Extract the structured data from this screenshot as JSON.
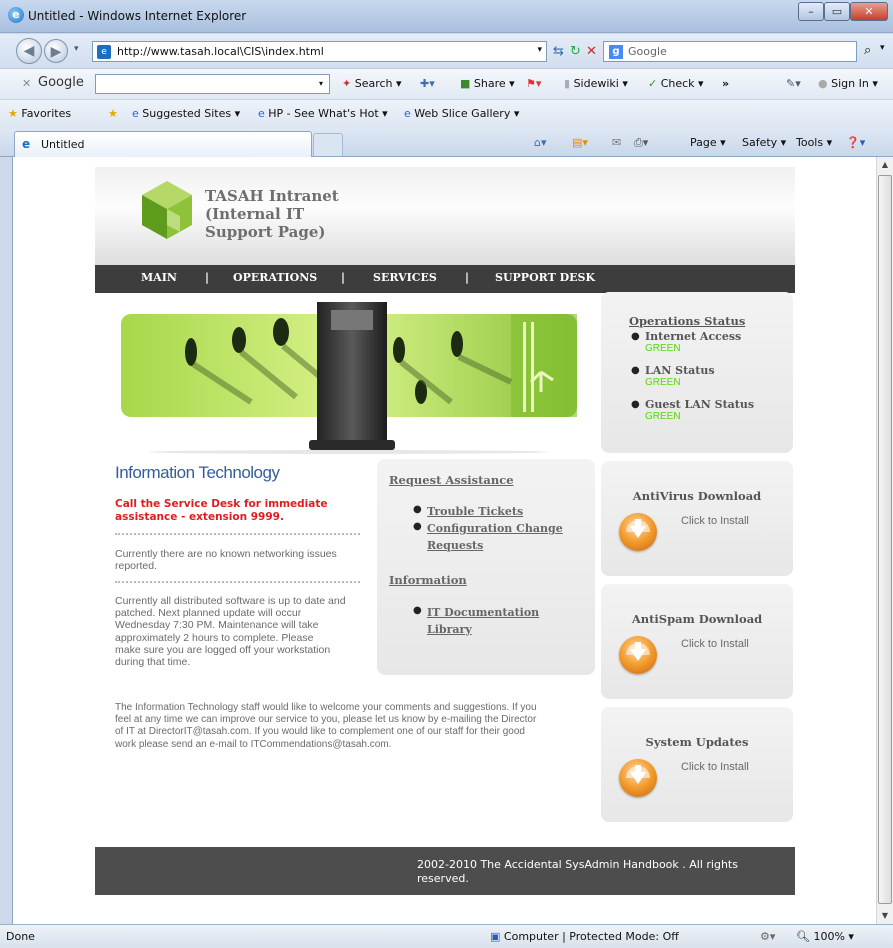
{
  "window": {
    "title": "Untitled - Windows Internet Explorer",
    "min": "–",
    "max": "▭",
    "close": "✕"
  },
  "nav": {
    "url": "http://www.tasah.local\\CIS\\index.html",
    "search_placeholder": "Google"
  },
  "google_toolbar": {
    "close": "✕",
    "brand": "Google",
    "search": "Search",
    "share": "Share",
    "sidewiki": "Sidewiki",
    "check": "Check",
    "more": "»",
    "sign_in": "Sign In"
  },
  "favorites_bar": {
    "favorites": "Favorites",
    "items": [
      "Suggested Sites",
      "HP - See What's Hot",
      "Web Slice Gallery"
    ]
  },
  "tab": {
    "title": "Untitled"
  },
  "command_bar": {
    "page": "Page",
    "safety": "Safety",
    "tools": "Tools"
  },
  "site": {
    "title_lines": [
      "TASAH Intranet",
      "(Internal IT",
      "Support Page)"
    ],
    "menu": [
      "MAIN",
      "OPERATIONS",
      "SERVICES",
      "SUPPORT DESK"
    ],
    "menu_sep": "|",
    "it_title": "Information Technology",
    "call_notice": "Call the Service Desk for immediate assistance - extension 9999.",
    "network_note": "Currently there are no known networking issues reported.",
    "software_note_lines": [
      "Currently all distributed software is up to date and",
      "patched. Next planned update will occur",
      "Wednesday 7:30 PM. Maintenance will take",
      "approximately 2 hours to complete. Please",
      "make sure you are logged off your workstation",
      "during that time."
    ],
    "welcome_lines": [
      "The Information Technology staff would like to welcome your comments and suggestions. If you",
      "feel at any time we can improve our service to you, please let us know by e-mailing the Director",
      "of IT at DirectorIT@tasah.com. If you would like to complement one of our staff for their good",
      "work please send an e-mail to ITCommendations@tasah.com."
    ],
    "request": {
      "heading": "Request Assistance",
      "links": [
        "Trouble Tickets",
        "Configuration Change Requests"
      ]
    },
    "information": {
      "heading": "Information",
      "links": [
        "IT Documentation Library"
      ]
    },
    "ops_status": {
      "heading": "Operations Status",
      "items": [
        {
          "label": "Internet Access",
          "status": "GREEN"
        },
        {
          "label": "LAN Status",
          "status": "GREEN"
        },
        {
          "label": "Guest LAN Status",
          "status": "GREEN"
        }
      ]
    },
    "downloads": [
      {
        "title": "AntiVirus Download",
        "action": "Click to Install"
      },
      {
        "title": "AntiSpam Download",
        "action": "Click to Install"
      },
      {
        "title": "System Updates",
        "action": "Click to Install"
      }
    ],
    "footer": "2002-2010 The Accidental SysAdmin Handbook . All rights reserved."
  },
  "status_bar": {
    "left": "Done",
    "zone": "Computer | Protected Mode: Off",
    "zoom": "100%"
  },
  "colors": {
    "status_green": "#4fdc00",
    "alert_red": "#e01d1d",
    "menu_bg": "#3d3d3d"
  }
}
